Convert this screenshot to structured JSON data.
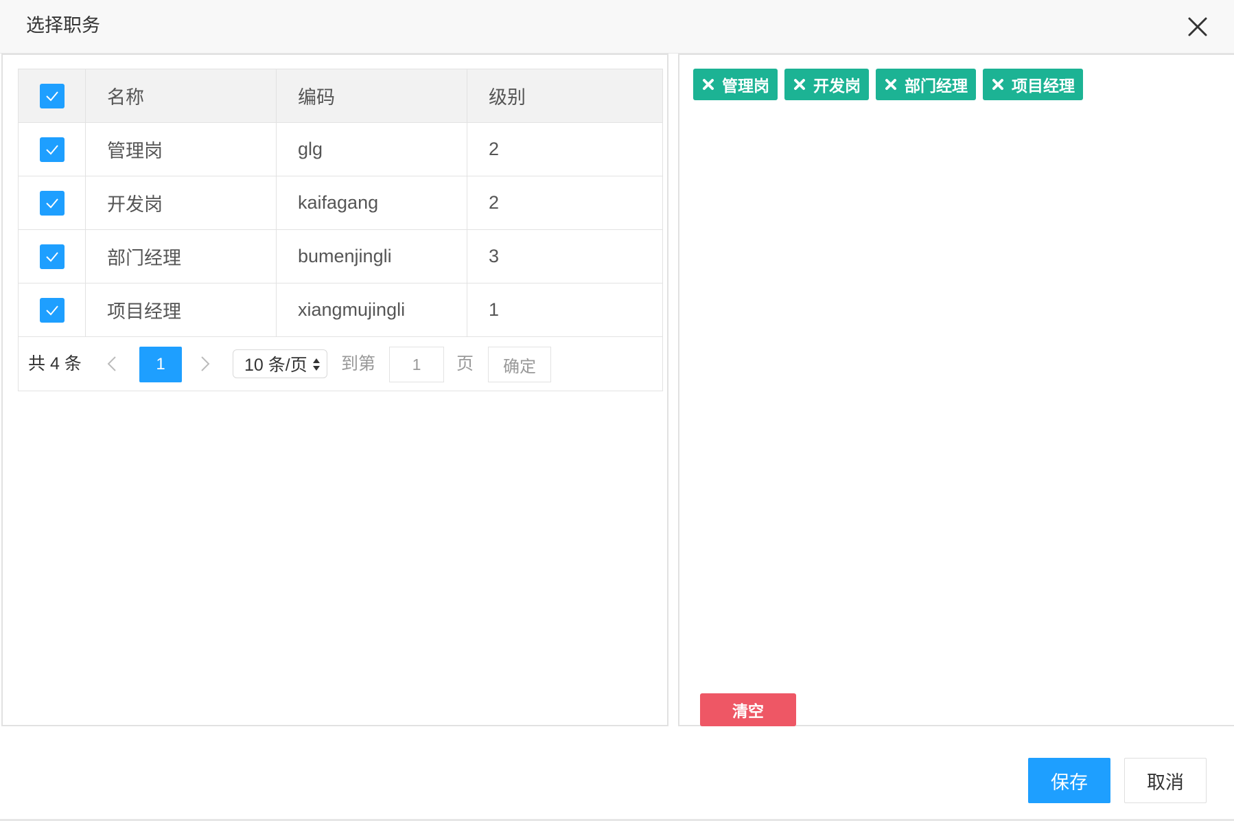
{
  "dialog": {
    "title": "选择职务",
    "close_icon": "close-icon"
  },
  "table": {
    "columns": [
      "名称",
      "编码",
      "级别"
    ],
    "header_checked": true,
    "rows": [
      {
        "name": "管理岗",
        "code": "glg",
        "level": "2",
        "checked": true
      },
      {
        "name": "开发岗",
        "code": "kaifagang",
        "level": "2",
        "checked": true
      },
      {
        "name": "部门经理",
        "code": "bumenjingli",
        "level": "3",
        "checked": true
      },
      {
        "name": "项目经理",
        "code": "xiangmujingli",
        "level": "1",
        "checked": true
      }
    ]
  },
  "pager": {
    "total": "共 4 条",
    "current_page": "1",
    "page_size": "10 条/页",
    "goto_label": "到第",
    "goto_value": "1",
    "page_label": "页",
    "confirm_label": "确定"
  },
  "selected": {
    "tags": [
      "管理岗",
      "开发岗",
      "部门经理",
      "项目经理"
    ],
    "clear_label": "清空"
  },
  "footer": {
    "save_label": "保存",
    "cancel_label": "取消"
  },
  "colors": {
    "primary": "#1e9fff",
    "tag": "#1cb394",
    "danger": "#ee5765"
  }
}
